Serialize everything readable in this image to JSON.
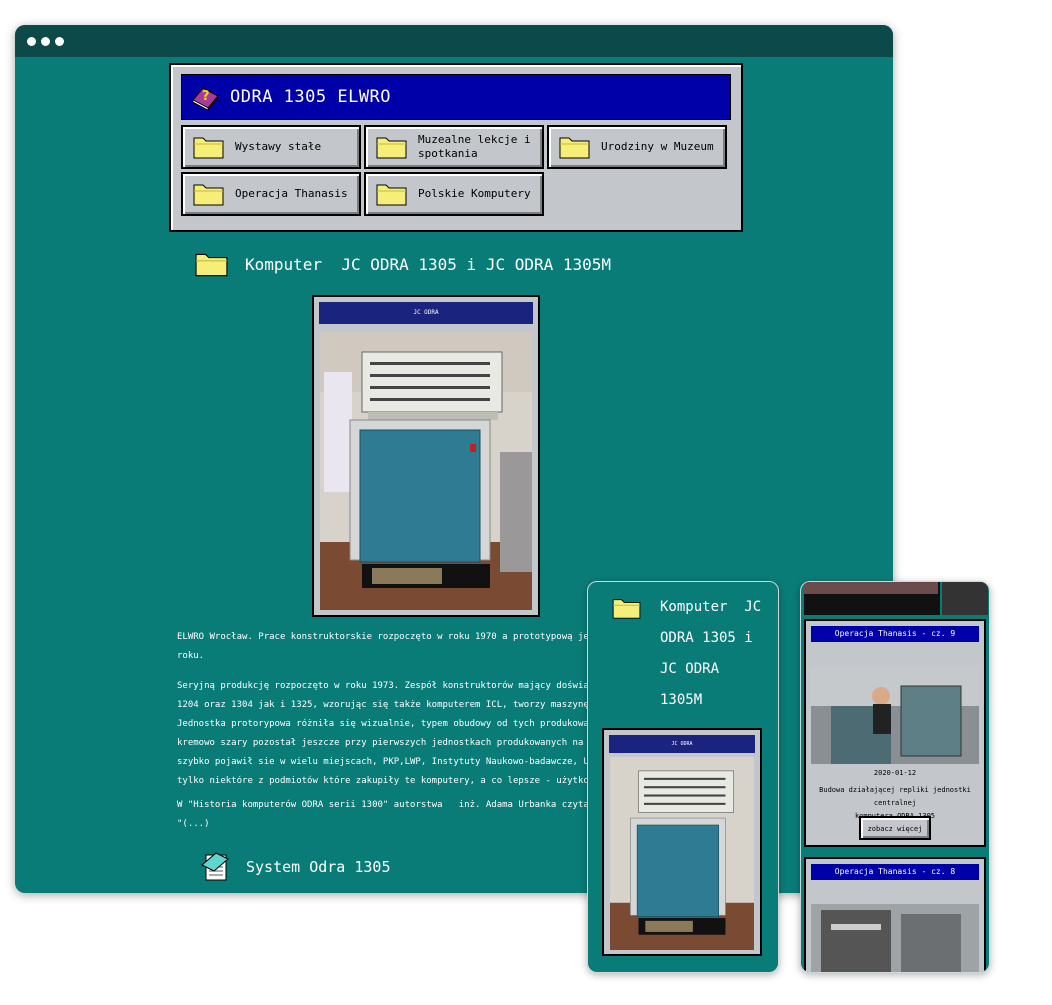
{
  "menu": {
    "title": "ODRA 1305 ELWRO",
    "items": [
      {
        "label": "Wystawy stałe"
      },
      {
        "label": "Muzealne lekcje i spotkania"
      },
      {
        "label": "Urodziny w Muzeum"
      },
      {
        "label": "Operacja Thanasis"
      },
      {
        "label": "Polskie Komputery"
      }
    ]
  },
  "main": {
    "heading": "Komputer  JC ODRA 1305 i JC ODRA 1305M",
    "photo_caption": "JC ODRA",
    "paragraphs": {
      "p1": [
        "ELWRO Wrocław. Prace konstruktorskie rozpoczęto w roku 1970 a prototypową jednostkę ur",
        "roku."
      ],
      "p2": [
        "Seryjną produkcję rozpoczęto w roku 1973. Zespół konstruktorów mający doświadczenie po",
        "1204 oraz 1304 jak i 1325, wzorując się także komputerem  ICL, tworzy maszynę cefrową",
        "Jednostka protorypowa różniła się wizualnie,  typem obudowy od tych produkowanych serw",
        "kremowo szary pozostał jeszcze przy pierwszych jednostkach produkowanych na skalę prze",
        "szybko pojawił sie w wielu miejscach, PKP,LWP, Instytuty Naukowo-badawcze, Uczelnie, p",
        "tylko niektóre z podmiotów które zakupiły te komputery, a co lepsze - użytkowały przez"
      ],
      "p3": [
        "W \"Historia komputerów ODRA serii 1300\" autorstwa   inż. Adama Urbanka czytamy min:",
        "\"(...)"
      ]
    },
    "heading2": "System Odra 1305"
  },
  "mobile1": {
    "heading_lines": [
      "Komputer  JC",
      "ODRA 1305 i",
      "JC ODRA",
      "1305M"
    ],
    "photo_caption": "JC ODRA"
  },
  "mobile2": {
    "cards": [
      {
        "title": "Operacja Thanasis - cz. 9",
        "date": "2020-01-12",
        "desc_lines": [
          "Budowa działającej repliki jednostki centralnej",
          "komputera ODRA 1305"
        ],
        "button": "zobacz więcej"
      },
      {
        "title": "Operacja Thanasis - cz. 8"
      }
    ]
  },
  "colors": {
    "background": "#0a7c78",
    "title_bar": "#0000a8",
    "panel": "#c3c7cb"
  }
}
